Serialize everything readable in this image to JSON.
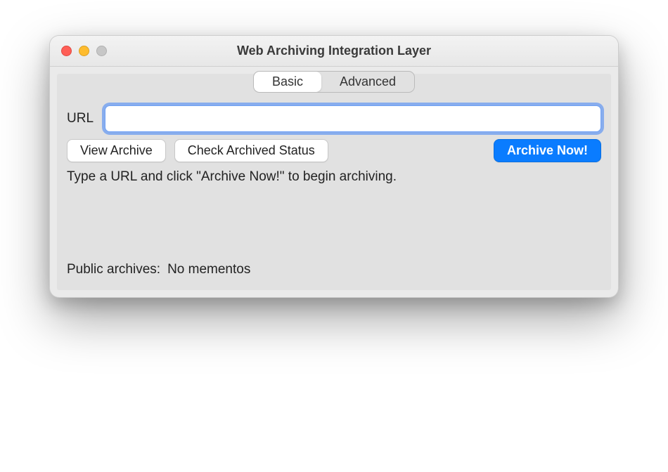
{
  "window": {
    "title": "Web Archiving Integration Layer"
  },
  "tabs": {
    "basic": "Basic",
    "advanced": "Advanced"
  },
  "url": {
    "label": "URL",
    "value": ""
  },
  "buttons": {
    "view_archive": "View Archive",
    "check_status": "Check Archived Status",
    "archive_now": "Archive Now!"
  },
  "instruction": "Type a URL and click \"Archive Now!\" to begin archiving.",
  "archives": {
    "label": "Public archives:",
    "value": "No mementos"
  }
}
